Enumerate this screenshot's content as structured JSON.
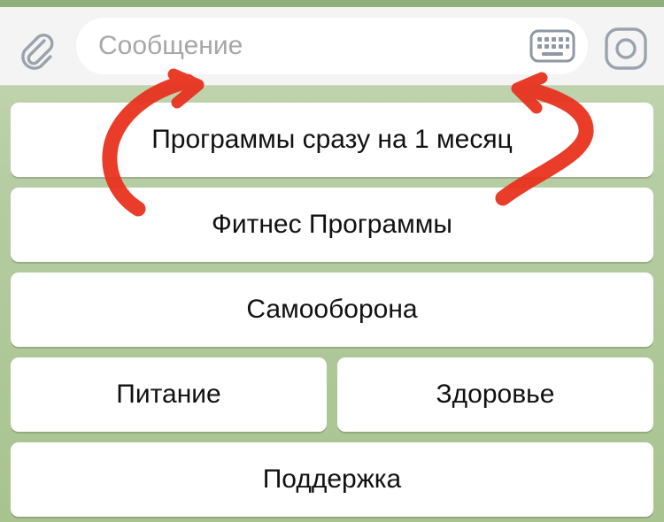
{
  "input_bar": {
    "placeholder": "Сообщение",
    "attach_icon": "paperclip-icon",
    "keyboard_icon": "keyboard-icon",
    "camera_icon": "camera-icon"
  },
  "keyboard": {
    "rows": [
      [
        "Программы сразу на 1 месяц"
      ],
      [
        "Фитнес Программы"
      ],
      [
        "Самооборона"
      ],
      [
        "Питание",
        "Здоровье"
      ],
      [
        "Поддержка"
      ]
    ]
  },
  "colors": {
    "chat_background": "#b6cca2",
    "input_bar_background": "#f4f4f4",
    "icon_color": "#9aa3ad",
    "annotation_arrow": "#e8321e"
  }
}
